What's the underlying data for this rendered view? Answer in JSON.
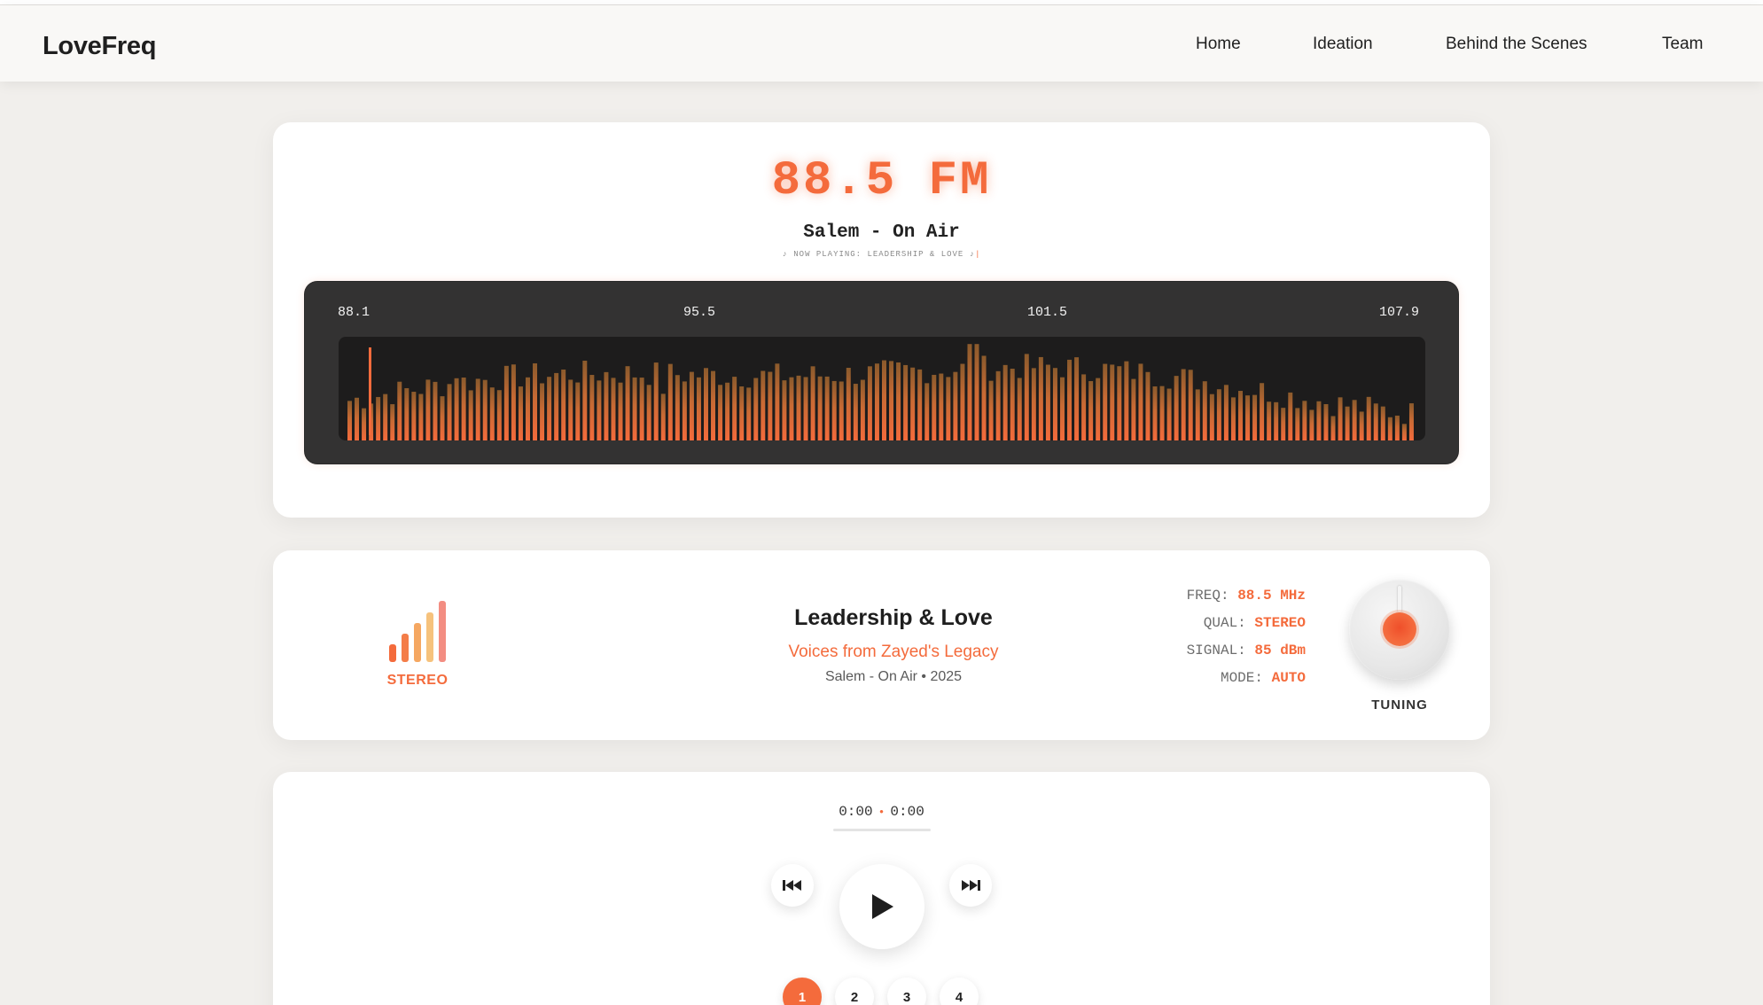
{
  "brand": "LoveFreq",
  "nav": {
    "home": "Home",
    "ideation": "Ideation",
    "behind": "Behind the Scenes",
    "team": "Team"
  },
  "display": {
    "frequency": "88.5 FM",
    "station": "Salem - On Air",
    "now_playing": "♪ NOW PLAYING: LEADERSHIP & LOVE ♪",
    "cursor": "|"
  },
  "spectrum": {
    "scale": [
      "88.1",
      "95.5",
      "101.5",
      "107.9"
    ]
  },
  "track": {
    "badge": "STEREO",
    "title": "Leadership & Love",
    "subtitle": "Voices from Zayed's Legacy",
    "meta": "Salem - On Air • 2025"
  },
  "stats": [
    {
      "key": "FREQ:",
      "value": "88.5 MHz"
    },
    {
      "key": "QUAL:",
      "value": "STEREO"
    },
    {
      "key": "SIGNAL:",
      "value": "85 dBm"
    },
    {
      "key": "MODE:",
      "value": "AUTO"
    }
  ],
  "knob": {
    "label": "TUNING"
  },
  "player": {
    "current_time": "0:00",
    "separator": "•",
    "duration": "0:00",
    "pages": [
      "1",
      "2",
      "3",
      "4"
    ],
    "active_page": "1"
  },
  "colors": {
    "accent": "#f46b3c",
    "panel_dark": "#333232"
  },
  "icons": {
    "prev": "skip-previous-icon",
    "play": "play-icon",
    "next": "skip-next-icon",
    "stereo": "signal-bars-icon"
  }
}
